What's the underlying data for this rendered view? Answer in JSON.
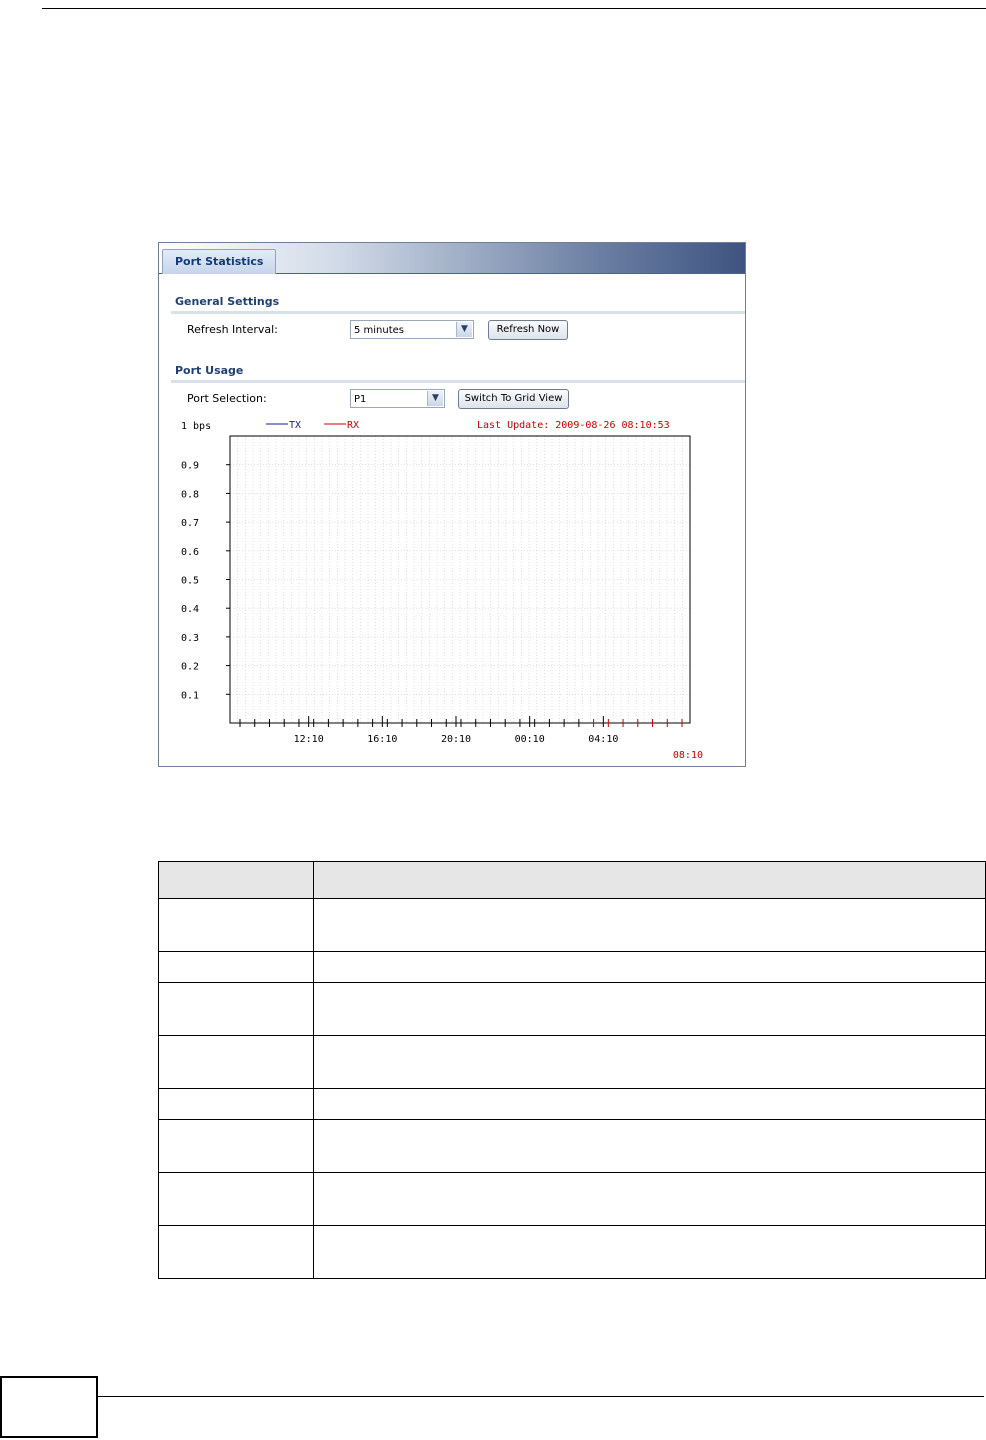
{
  "panel": {
    "tab_label": "Port Statistics",
    "general_settings_title": "General Settings",
    "refresh_interval_label": "Refresh Interval:",
    "refresh_interval_value": "5 minutes",
    "refresh_now_label": "Refresh Now",
    "port_usage_title": "Port Usage",
    "port_selection_label": "Port Selection:",
    "port_selection_value": "P1",
    "switch_grid_label": "Switch To Grid View"
  },
  "chart_data": {
    "type": "line",
    "ylabel": "1 bps",
    "y_ticks": [
      "0.9",
      "0.8",
      "0.7",
      "0.6",
      "0.5",
      "0.4",
      "0.3",
      "0.2",
      "0.1"
    ],
    "ylim": [
      0,
      1
    ],
    "x_ticks": [
      "12:10",
      "16:10",
      "20:10",
      "00:10",
      "04:10"
    ],
    "x_current": "08:10",
    "legend": "top",
    "series": [
      {
        "name": "TX",
        "color": "#1a1aa0",
        "values": []
      },
      {
        "name": "RX",
        "color": "#cc0000",
        "values": []
      }
    ],
    "last_update": "Last Update: 2009-08-26 08:10:53",
    "grid": true
  },
  "table": {
    "header": [
      "",
      ""
    ],
    "rows": [
      [
        "",
        ""
      ],
      [
        "",
        ""
      ],
      [
        "",
        ""
      ],
      [
        "",
        ""
      ],
      [
        "",
        ""
      ],
      [
        "",
        ""
      ],
      [
        "",
        ""
      ],
      [
        "",
        ""
      ]
    ]
  }
}
